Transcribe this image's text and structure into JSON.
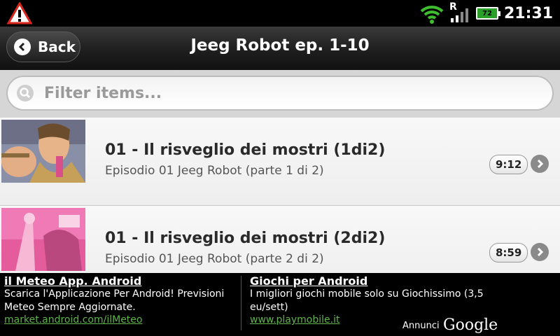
{
  "status_bar": {
    "time": "21:31",
    "battery": "72",
    "network": "R",
    "icons": [
      "warning-icon",
      "wifi-icon",
      "signal-icon",
      "battery-icon"
    ]
  },
  "title_bar": {
    "back_label": "Back",
    "title": "Jeeg Robot ep. 1-10"
  },
  "filter": {
    "placeholder": "Filter items..."
  },
  "items": [
    {
      "title": "01 - Il risveglio dei mostri (1di2)",
      "subtitle": "Episodio 01 Jeeg Robot (parte 1 di 2)",
      "duration": "9:12",
      "thumbnail": "episode-thumbnail"
    },
    {
      "title": "01 - Il risveglio dei mostri (2di2)",
      "subtitle": "Episodio 01 Jeeg Robot (parte 2 di 2)",
      "duration": "8:59",
      "thumbnail": "episode-thumbnail"
    }
  ],
  "ads": [
    {
      "title": "il Meteo App. Android",
      "text": "Scarica l'Applicazione Per Android! Previsioni Meteo Sempre Aggiornate.",
      "link": "market.android.com/ilMeteo"
    },
    {
      "title": "Giochi per Android",
      "text": "I migliori giochi mobile solo su Giochissimo (3,5 eu/sett)",
      "link": "www.playmobile.it"
    }
  ],
  "ad_footer": {
    "annunci": "Annunci",
    "google": "Google"
  },
  "colors": {
    "ad_link": "#5fb34b",
    "battery": "#2aa02a",
    "wifi": "#3fbf2f",
    "warning": "#d9261c"
  }
}
